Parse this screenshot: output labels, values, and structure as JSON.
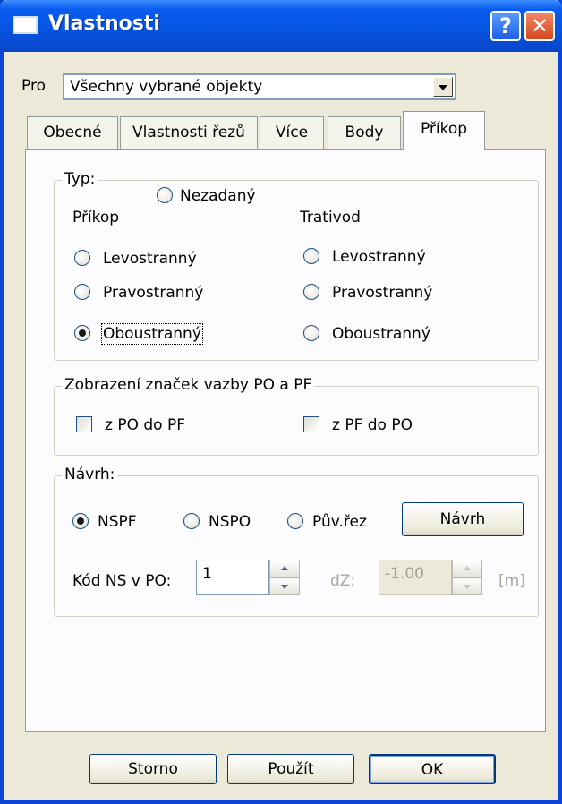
{
  "window": {
    "title": "Vlastnosti",
    "help_glyph": "?",
    "close_glyph": "✕"
  },
  "pro": {
    "label": "Pro",
    "value": "Všechny vybrané objekty"
  },
  "tabs": [
    {
      "label": "Obecné"
    },
    {
      "label": "Vlastnosti řezů"
    },
    {
      "label": "Více"
    },
    {
      "label": "Body"
    },
    {
      "label": "Příkop",
      "active": true
    }
  ],
  "typ": {
    "legend": "Typ:",
    "nezadany": "Nezadaný",
    "prikop_heading": "Příkop",
    "trativod_heading": "Trativod",
    "prikop_options": [
      "Levostranný",
      "Pravostranný",
      "Oboustranný"
    ],
    "trativod_options": [
      "Levostranný",
      "Pravostranný",
      "Oboustranný"
    ],
    "selected": "prikop-oboustranny"
  },
  "zobrazeni": {
    "legend": "Zobrazení značek vazby PO a PF",
    "po_do_pf": "z PO do PF",
    "pf_do_po": "z PF do PO"
  },
  "navrh": {
    "legend": "Návrh:",
    "options": [
      "NSPF",
      "NSPO",
      "Pův.řez"
    ],
    "selected": "NSPF",
    "button": "Návrh",
    "kod_label": "Kód NS v PO:",
    "kod_value": "1",
    "dz_label": "dZ:",
    "dz_value": "-1.00",
    "unit": "[m]"
  },
  "buttons": {
    "storno": "Storno",
    "pouzit": "Použít",
    "ok": "OK"
  }
}
